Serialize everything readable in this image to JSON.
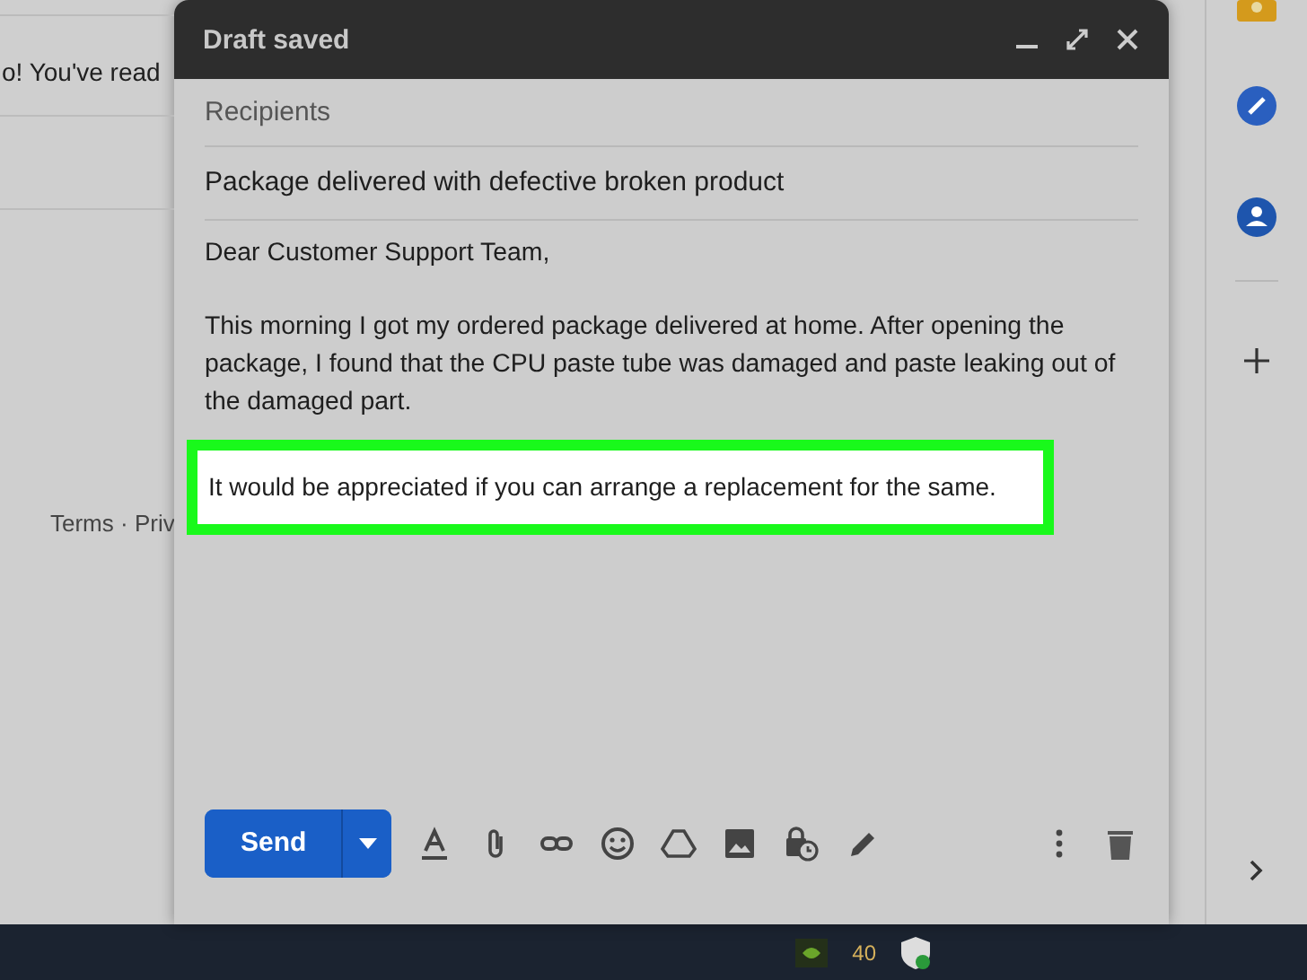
{
  "background": {
    "message_snippet": "o! You've read",
    "footer_links": "Terms · Priv"
  },
  "compose": {
    "title": "Draft saved",
    "recipients": {
      "placeholder": "Recipients"
    },
    "subject": "Package delivered with defective broken product",
    "body": [
      "Dear Customer Support Team,",
      "This morning I got my ordered package delivered at home. After opening the package, I found that the CPU paste tube was damaged and paste leaking out of the damaged part."
    ],
    "highlighted_line": "It would be appreciated if you can arrange a replacement for the same.",
    "send_label": "Send"
  },
  "taskbar": {
    "tray_reading": "40"
  }
}
